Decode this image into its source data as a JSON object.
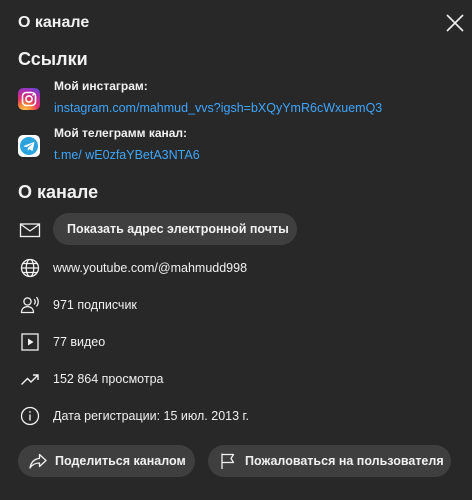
{
  "dialog": {
    "title": "О канале"
  },
  "links_section": {
    "heading": "Ссылки",
    "items": [
      {
        "icon": "instagram-icon",
        "title": "Мой инстаграм:",
        "url": "instagram.com/mahmud_vvs?igsh=bXQyYmR6cWxuemQ3"
      },
      {
        "icon": "telegram-icon",
        "title": "Мой телеграмм канал:",
        "url": "t.me/ wE0zfaYBetA3NTA6"
      }
    ]
  },
  "about_section": {
    "heading": "О канале",
    "email_button": "Показать адрес электронной почты",
    "channel_url": "www.youtube.com/@mahmudd998",
    "subscribers": "971 подписчик",
    "videos": "77 видео",
    "views": "152 864 просмотра",
    "joined": "Дата регистрации: 15 июл. 2013 г."
  },
  "actions": {
    "share": "Поделиться каналом",
    "report": "Пожаловаться на пользователя"
  },
  "colors": {
    "background": "#282828",
    "text": "#f1f1f1",
    "link": "#3ea6ff",
    "button": "#3f3f3f",
    "telegram": "#2aa3df"
  }
}
